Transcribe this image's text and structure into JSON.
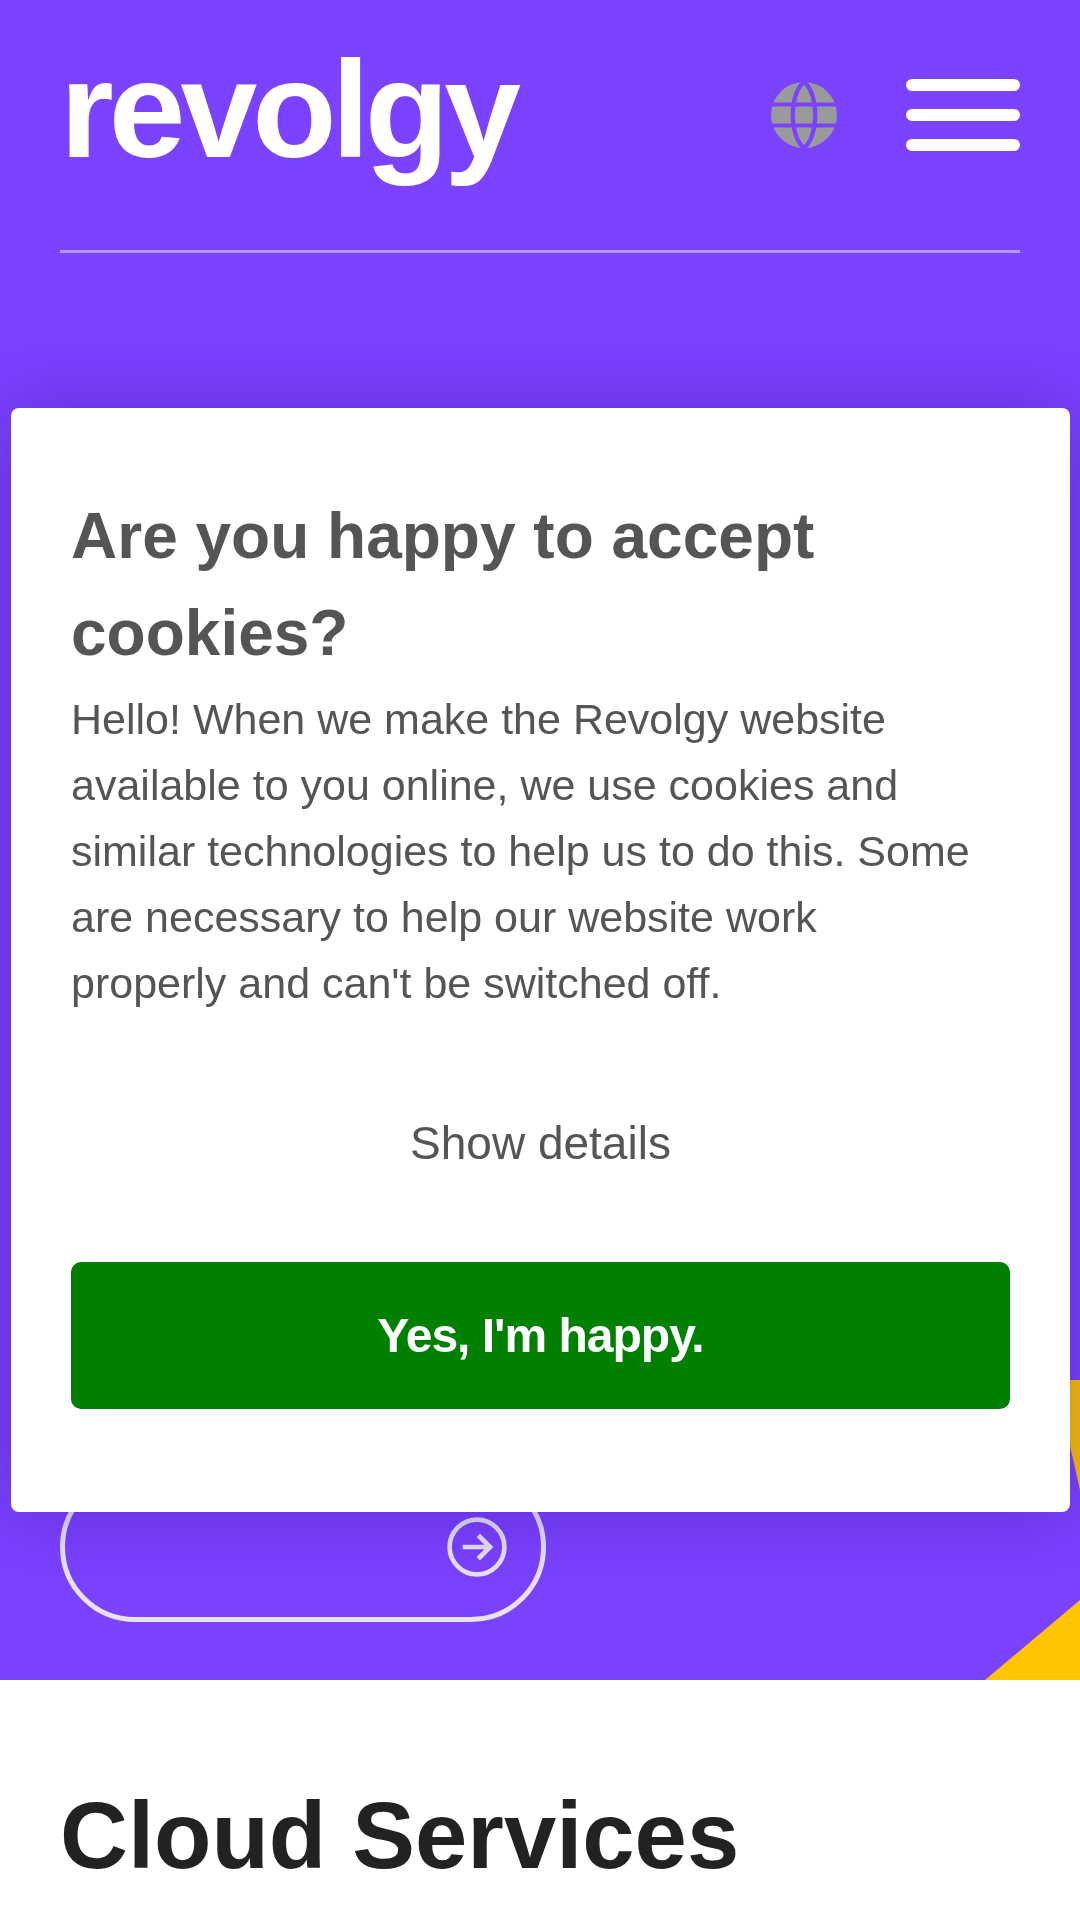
{
  "header": {
    "logo": "revolgy"
  },
  "cookie_dialog": {
    "title": "Are you happy to accept cookies?",
    "body": "Hello! When we make the Revolgy website available to you online, we use cookies and similar technologies to help us to do this. Some are necessary to help our website work properly and can't be switched off.",
    "details_link": "Show details",
    "accept_button": "Yes, I'm happy."
  },
  "section": {
    "title": "Cloud Services"
  }
}
